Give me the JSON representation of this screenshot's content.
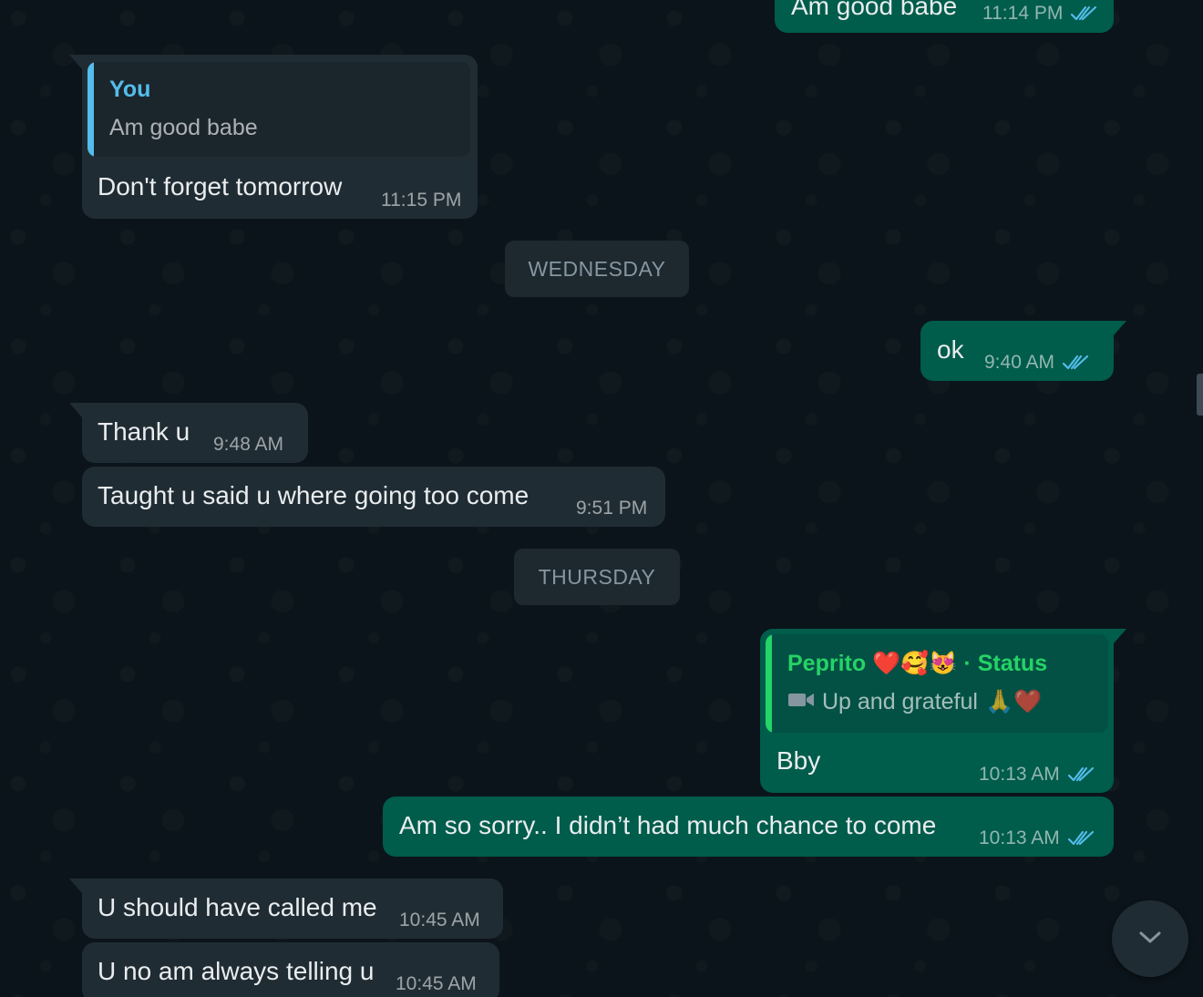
{
  "messages": [
    {
      "id": "m0",
      "text": "Am good babe",
      "time": "11:14 PM"
    },
    {
      "id": "m1",
      "quote_author": "You",
      "quote_text": "Am good babe",
      "text": "Don't forget tomorrow",
      "time": "11:15 PM"
    },
    {
      "id": "m2",
      "text": "ok",
      "time": "9:40 AM"
    },
    {
      "id": "m3",
      "text": "Thank u",
      "time": "9:48 AM"
    },
    {
      "id": "m4",
      "text": "Taught u said u where going too come",
      "time": "9:51 PM"
    },
    {
      "id": "m5",
      "quote_author": "Peprito",
      "quote_author_emoji": "❤️🥰😻",
      "quote_tag": "· Status",
      "quote_text": "Up and grateful",
      "quote_text_emoji": "🙏❤️",
      "text": "Bby",
      "time": "10:13 AM"
    },
    {
      "id": "m6",
      "text": "Am so sorry.. I didn’t had much chance to come",
      "time": "10:13 AM"
    },
    {
      "id": "m7",
      "text": "U should have called me",
      "time": "10:45 AM"
    },
    {
      "id": "m8",
      "text": "U no am always telling u",
      "time": "10:45 AM"
    }
  ],
  "day_separators": [
    "WEDNESDAY",
    "THURSDAY"
  ],
  "icons": {
    "read_receipt": "double-check-icon",
    "video": "video-camera-icon",
    "scroll_down": "chevron-down-icon"
  },
  "colors": {
    "background": "#0b141a",
    "incoming_bubble": "#202c33",
    "outgoing_bubble": "#005c4b",
    "read_receipt": "#53bdeb",
    "quote_you": "#53bdeb",
    "quote_status": "#25d366"
  }
}
